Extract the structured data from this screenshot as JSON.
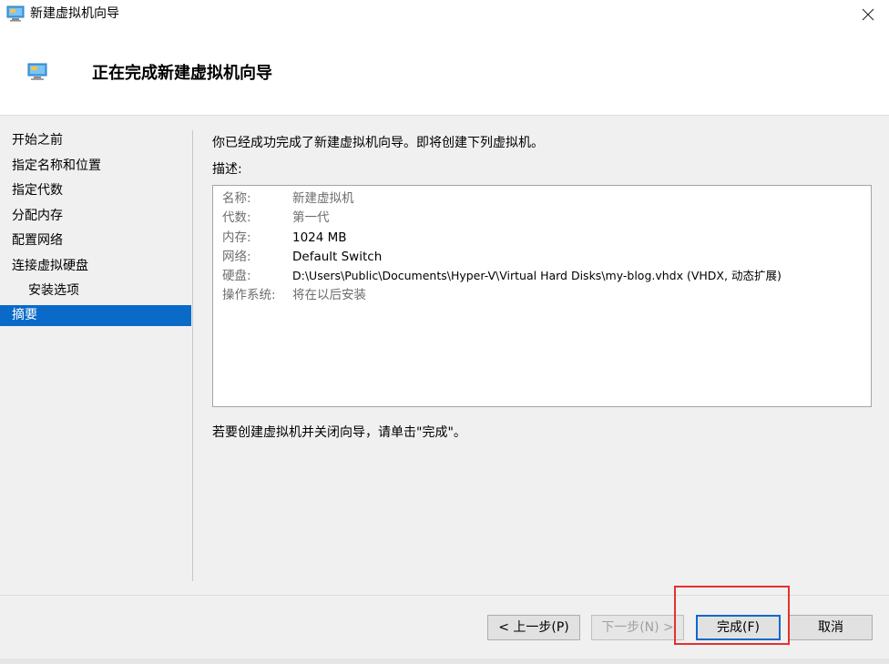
{
  "window": {
    "title": "新建虚拟机向导",
    "icon": "monitor-icon",
    "close_icon": "close-icon"
  },
  "header": {
    "title": "正在完成新建虚拟机向导",
    "icon": "monitor-icon"
  },
  "steps": [
    {
      "label": "开始之前",
      "active": false,
      "sub": false
    },
    {
      "label": "指定名称和位置",
      "active": false,
      "sub": false
    },
    {
      "label": "指定代数",
      "active": false,
      "sub": false
    },
    {
      "label": "分配内存",
      "active": false,
      "sub": false
    },
    {
      "label": "配置网络",
      "active": false,
      "sub": false
    },
    {
      "label": "连接虚拟硬盘",
      "active": false,
      "sub": false
    },
    {
      "label": "安装选项",
      "active": false,
      "sub": true
    },
    {
      "label": "摘要",
      "active": true,
      "sub": false
    }
  ],
  "main": {
    "intro": "你已经成功完成了新建虚拟机向导。即将创建下列虚拟机。",
    "desc_label": "描述:",
    "summary": [
      {
        "key": "名称:",
        "value": "新建虚拟机"
      },
      {
        "key": "代数:",
        "value": "第一代"
      },
      {
        "key": "内存:",
        "value": "1024 MB"
      },
      {
        "key": "网络:",
        "value": "Default Switch"
      },
      {
        "key": "硬盘:",
        "value": "D:\\Users\\Public\\Documents\\Hyper-V\\Virtual Hard Disks\\my-blog.vhdx (VHDX, 动态扩展)"
      },
      {
        "key": "操作系统:",
        "value": "将在以后安装"
      }
    ],
    "footer_note": "若要创建虚拟机并关闭向导，请单击\"完成\"。"
  },
  "buttons": {
    "prev": "< 上一步(P)",
    "next": "下一步(N) >",
    "finish": "完成(F)",
    "cancel": "取消"
  },
  "colors": {
    "accent": "#0a6ac8",
    "highlight": "#e53030"
  }
}
